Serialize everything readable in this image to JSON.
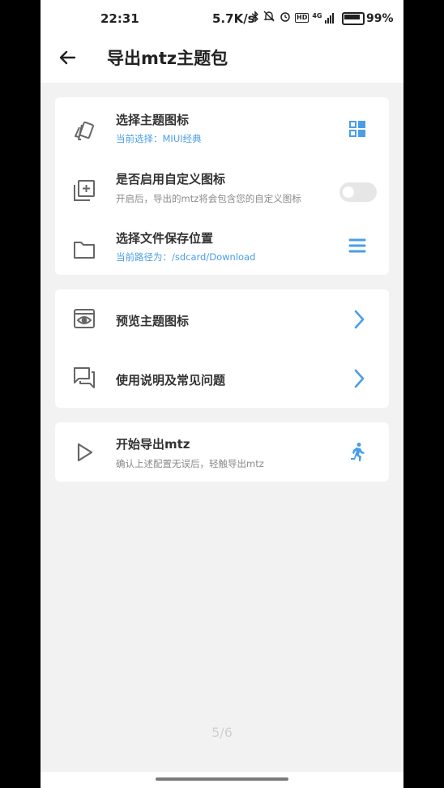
{
  "status_bar": {
    "time": "22:31",
    "net_speed": "5.7K/s",
    "network": "4G",
    "hd": "HD",
    "battery": "99%"
  },
  "app_bar": {
    "back_icon": "arrow-left-icon",
    "title": "导出mtz主题包"
  },
  "settings": {
    "items": [
      {
        "title": "选择主题图标",
        "subtitle": "当前选择：MIUI经典",
        "icon": "cards-icon",
        "action_icon": "grid-icon"
      },
      {
        "title": "是否启用自定义图标",
        "subtitle": "开启后，导出的mtz将会包含您的自定义图标",
        "icon": "add-photos-icon",
        "toggle": false
      },
      {
        "title": "选择文件保存位置",
        "subtitle": "当前路径为：/sdcard/Download",
        "icon": "folder-icon",
        "action_icon": "menu-icon"
      }
    ]
  },
  "links": {
    "items": [
      {
        "title": "预览主题图标",
        "icon": "preview-eye-icon",
        "action_icon": "chevron-right-icon"
      },
      {
        "title": "使用说明及常见问题",
        "icon": "forum-icon",
        "action_icon": "chevron-right-icon"
      }
    ]
  },
  "export": {
    "title": "开始导出mtz",
    "subtitle": "确认上述配置无误后，轻触导出mtz",
    "icon": "play-icon",
    "action_icon": "running-person-icon"
  },
  "pager": "5/6",
  "colors": {
    "accent": "#4a9ee8",
    "background": "#f2f2f2",
    "card": "#ffffff",
    "icon_gray": "#666666"
  }
}
